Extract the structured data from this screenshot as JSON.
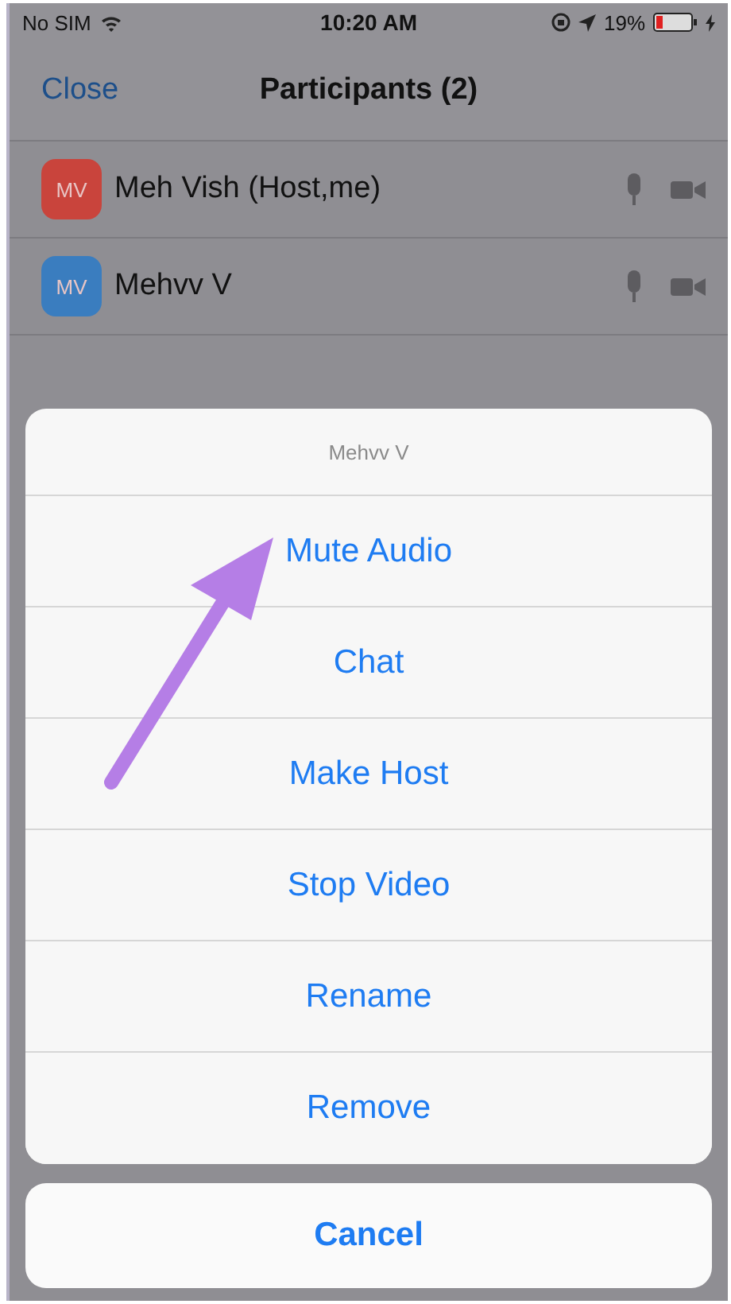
{
  "status_bar": {
    "carrier": "No SIM",
    "time": "10:20 AM",
    "battery_percent": "19%"
  },
  "nav_bar": {
    "left_button": "Close",
    "title": "Participants (2)"
  },
  "participants": [
    {
      "initials": "MV",
      "name": "Meh Vish (Host,me)",
      "color": "#c9443c"
    },
    {
      "initials": "MV",
      "name": "Mehvv V",
      "color": "#3a7dbf"
    }
  ],
  "action_sheet": {
    "title": "Mehvv V",
    "actions": [
      "Mute Audio",
      "Chat",
      "Make Host",
      "Stop Video",
      "Rename",
      "Remove"
    ],
    "cancel": "Cancel"
  }
}
